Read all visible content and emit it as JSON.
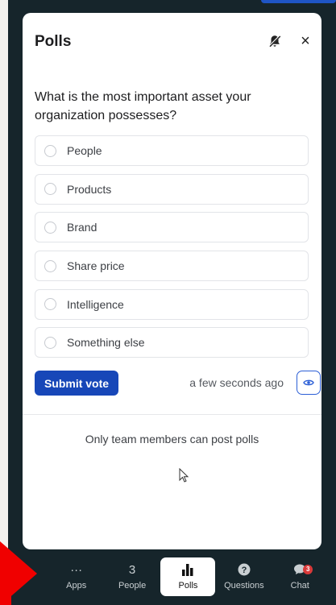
{
  "panel": {
    "title": "Polls",
    "mute_icon": "bell-off-icon",
    "close_label": "×"
  },
  "poll": {
    "question": "What is the most important asset your organization possesses?",
    "options": [
      "People",
      "Products",
      "Brand",
      "Share price",
      "Intelligence",
      "Something else"
    ],
    "submit_label": "Submit vote",
    "timestamp": "a few seconds ago",
    "view_icon": "eye-icon"
  },
  "footer_notice": "Only team members can post polls",
  "nav": {
    "apps": {
      "top": "···",
      "label": "Apps"
    },
    "people": {
      "top": "3",
      "label": "People"
    },
    "polls": {
      "label": "Polls",
      "icon": "bar-chart-icon"
    },
    "questions": {
      "label": "Questions",
      "icon": "question-icon"
    },
    "chat": {
      "label": "Chat",
      "badge": "3",
      "icon": "chat-bubble-icon"
    }
  },
  "colors": {
    "background": "#16252b",
    "accent": "#1747b8",
    "badge": "#d93a3a",
    "highlight": "#f00000"
  }
}
